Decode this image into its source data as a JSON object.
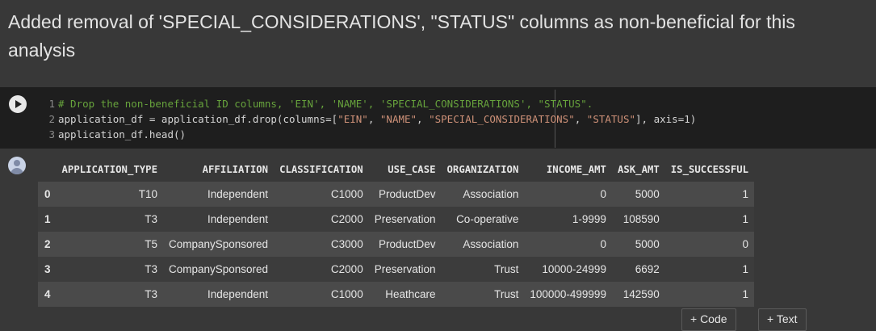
{
  "markdown": {
    "text": "Added removal of 'SPECIAL_CONSIDERATIONS', \"STATUS\" columns as non-beneficial for this analysis"
  },
  "code": {
    "line_numbers": [
      "1",
      "2",
      "3"
    ],
    "line1": "# Drop the non-beneficial ID columns, 'EIN', 'NAME', 'SPECIAL_CONSIDERATIONS', \"STATUS\".",
    "line2_pre": "application_df = application_df.drop(columns=[",
    "line2_s1": "\"EIN\"",
    "line2_sep1": ", ",
    "line2_s2": "\"NAME\"",
    "line2_sep2": ", ",
    "line2_s3": "\"SPECIAL_CONSIDERATIONS\"",
    "line2_sep3": ", ",
    "line2_s4": "\"STATUS\"",
    "line2_post": "], axis=1)",
    "line3": "application_df.head()"
  },
  "table": {
    "columns": [
      "",
      "APPLICATION_TYPE",
      "AFFILIATION",
      "CLASSIFICATION",
      "USE_CASE",
      "ORGANIZATION",
      "INCOME_AMT",
      "ASK_AMT",
      "IS_SUCCESSFUL"
    ],
    "rows": [
      [
        "0",
        "T10",
        "Independent",
        "C1000",
        "ProductDev",
        "Association",
        "0",
        "5000",
        "1"
      ],
      [
        "1",
        "T3",
        "Independent",
        "C2000",
        "Preservation",
        "Co-operative",
        "1-9999",
        "108590",
        "1"
      ],
      [
        "2",
        "T5",
        "CompanySponsored",
        "C3000",
        "ProductDev",
        "Association",
        "0",
        "5000",
        "0"
      ],
      [
        "3",
        "T3",
        "CompanySponsored",
        "C2000",
        "Preservation",
        "Trust",
        "10000-24999",
        "6692",
        "1"
      ],
      [
        "4",
        "T3",
        "Independent",
        "C1000",
        "Heathcare",
        "Trust",
        "100000-499999",
        "142590",
        "1"
      ]
    ]
  },
  "toolbar": {
    "add_code": "+ Code",
    "add_text": "+ Text"
  },
  "icons": {
    "run": "play-icon",
    "output": "user-avatar-icon"
  }
}
